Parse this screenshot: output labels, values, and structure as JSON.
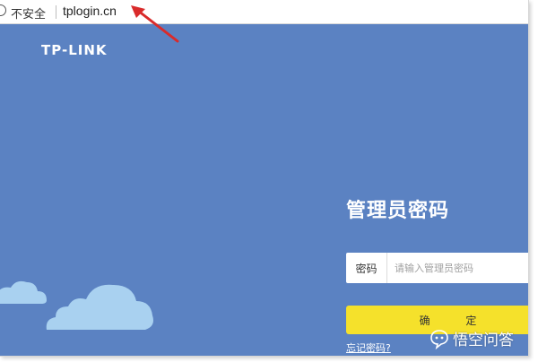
{
  "browser": {
    "security_label": "不安全",
    "url": "tplogin.cn"
  },
  "page": {
    "logo": "TP-LINK",
    "title": "管理员密码",
    "password_label": "密码",
    "password_placeholder": "请输入管理员密码",
    "confirm_label": "确 定",
    "forgot_link": "忘记密码?"
  },
  "watermark": {
    "text": "悟空问答",
    "icon": "wukong-logo-icon"
  },
  "colors": {
    "page_background": "#5b82c2",
    "confirm_button": "#f5e12b",
    "annotation_arrow": "#d92b2b",
    "cloud": "#a9d1f0"
  },
  "icons": {
    "security": "info-icon",
    "arrow": "red-arrow-annotation"
  }
}
